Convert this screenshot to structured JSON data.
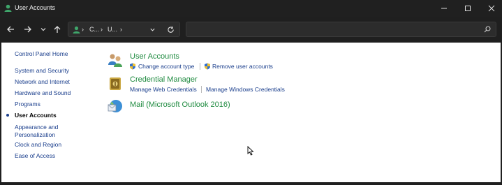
{
  "window": {
    "title": "User Accounts"
  },
  "address_bar": {
    "crumbs": [
      "C...",
      "U...",
      ""
    ]
  },
  "search": {
    "placeholder": ""
  },
  "sidebar": {
    "home": "Control Panel Home",
    "items": [
      {
        "label": "System and Security",
        "active": false
      },
      {
        "label": "Network and Internet",
        "active": false
      },
      {
        "label": "Hardware and Sound",
        "active": false
      },
      {
        "label": "Programs",
        "active": false
      },
      {
        "label": "User Accounts",
        "active": true
      },
      {
        "label": "Appearance and Personalization",
        "active": false
      },
      {
        "label": "Clock and Region",
        "active": false
      },
      {
        "label": "Ease of Access",
        "active": false
      }
    ]
  },
  "categories": [
    {
      "title": "User Accounts",
      "icon": "users-icon",
      "links": [
        "Change account type",
        "Remove user accounts"
      ]
    },
    {
      "title": "Credential Manager",
      "icon": "credential-vault-icon",
      "links": [
        "Manage Web Credentials",
        "Manage Windows Credentials"
      ]
    },
    {
      "title": "Mail (Microsoft Outlook 2016)",
      "icon": "mail-icon",
      "links": []
    }
  ],
  "colors": {
    "titlebar": "#202020",
    "category_title": "#1e8a3f",
    "link": "#1a3e8c"
  }
}
